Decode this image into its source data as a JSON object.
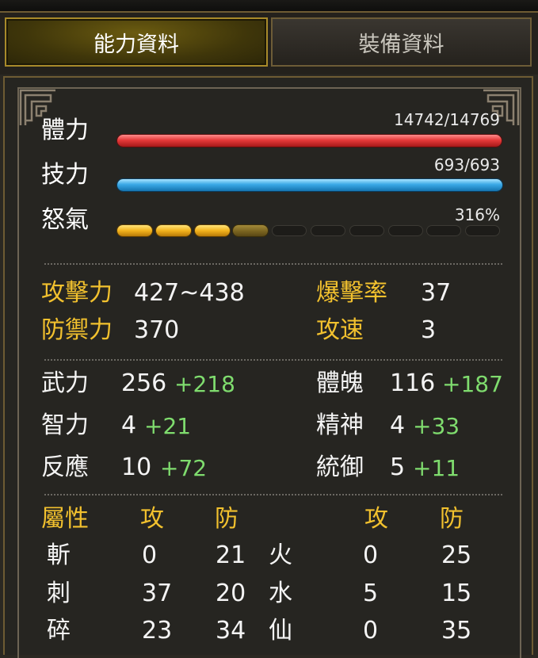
{
  "tabs": [
    {
      "label": "能力資料",
      "active": true
    },
    {
      "label": "裝備資料",
      "active": false
    }
  ],
  "bars": {
    "hp": {
      "label": "體力",
      "value_text": "14742/14769",
      "current": 14742,
      "max": 14769,
      "color": "#e63a3a"
    },
    "mp": {
      "label": "技力",
      "value_text": "693/693",
      "current": 693,
      "max": 693,
      "color": "#3aa8e6"
    },
    "rage": {
      "label": "怒氣",
      "value_text": "316%",
      "segments_total": 10,
      "segments_full": 3,
      "segments_partial": 1
    }
  },
  "combat": {
    "attack_label": "攻擊力",
    "attack_value": "427~438",
    "crit_label": "爆擊率",
    "crit_value": "37",
    "defense_label": "防禦力",
    "defense_value": "370",
    "speed_label": "攻速",
    "speed_value": "3"
  },
  "base_stats": [
    {
      "label": "武力",
      "base": "256",
      "bonus": "+218"
    },
    {
      "label": "體魄",
      "base": "116",
      "bonus": "+187"
    },
    {
      "label": "智力",
      "base": "4",
      "bonus": "+21"
    },
    {
      "label": "精神",
      "base": "4",
      "bonus": "+33"
    },
    {
      "label": "反應",
      "base": "10",
      "bonus": "+72"
    },
    {
      "label": "統御",
      "base": "5",
      "bonus": "+11"
    }
  ],
  "attributes": {
    "header": {
      "title": "屬性",
      "atk": "攻",
      "def": "防",
      "atk2": "攻",
      "def2": "防"
    },
    "rows": [
      {
        "left_name": "斬",
        "left_atk": "0",
        "left_def": "21",
        "right_name": "火",
        "right_atk": "0",
        "right_def": "25"
      },
      {
        "left_name": "刺",
        "left_atk": "37",
        "left_def": "20",
        "right_name": "水",
        "right_atk": "5",
        "right_def": "15"
      },
      {
        "left_name": "碎",
        "left_atk": "23",
        "left_def": "34",
        "right_name": "仙",
        "right_atk": "0",
        "right_def": "35"
      }
    ]
  },
  "colors": {
    "accent_gold": "#f2c12e",
    "bonus_green": "#7fdc6e",
    "frame": "#6e5b33"
  }
}
